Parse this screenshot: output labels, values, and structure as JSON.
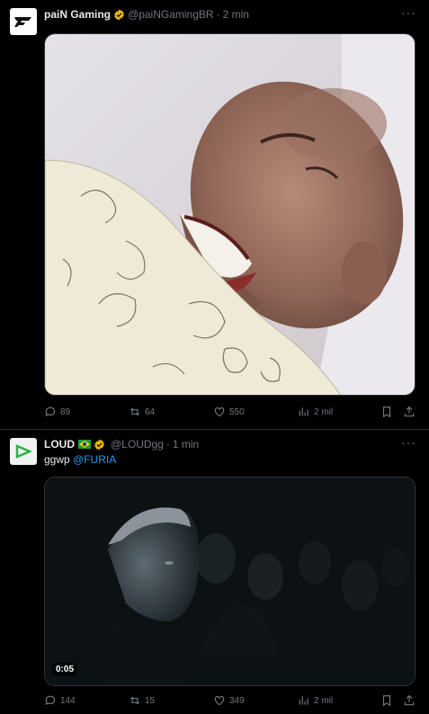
{
  "tweets": [
    {
      "name": "paiN Gaming",
      "handle": "@paiNGamingBR",
      "sep": "·",
      "time": "2 min",
      "text": "",
      "avatar_icon": "pain-logo",
      "stats": {
        "replies": "89",
        "retweets": "64",
        "likes": "550",
        "views": "2 mil"
      },
      "media_alt": "laughing-man-in-bed-video"
    },
    {
      "name": "LOUD",
      "handle": "@LOUDgg",
      "sep": "·",
      "time": "1 min",
      "text": "ggwp",
      "mention": "@FURIA",
      "avatar_icon": "loud-logo",
      "video_time": "0:05",
      "stats": {
        "replies": "144",
        "retweets": "15",
        "likes": "349",
        "views": "2 mil"
      },
      "media_alt": "cinema-audience-video"
    }
  ],
  "colors": {
    "verified": "#e8b50b",
    "accent": "#1d9bf0",
    "muted": "#71767b",
    "loud_green": "#2ab34a"
  }
}
